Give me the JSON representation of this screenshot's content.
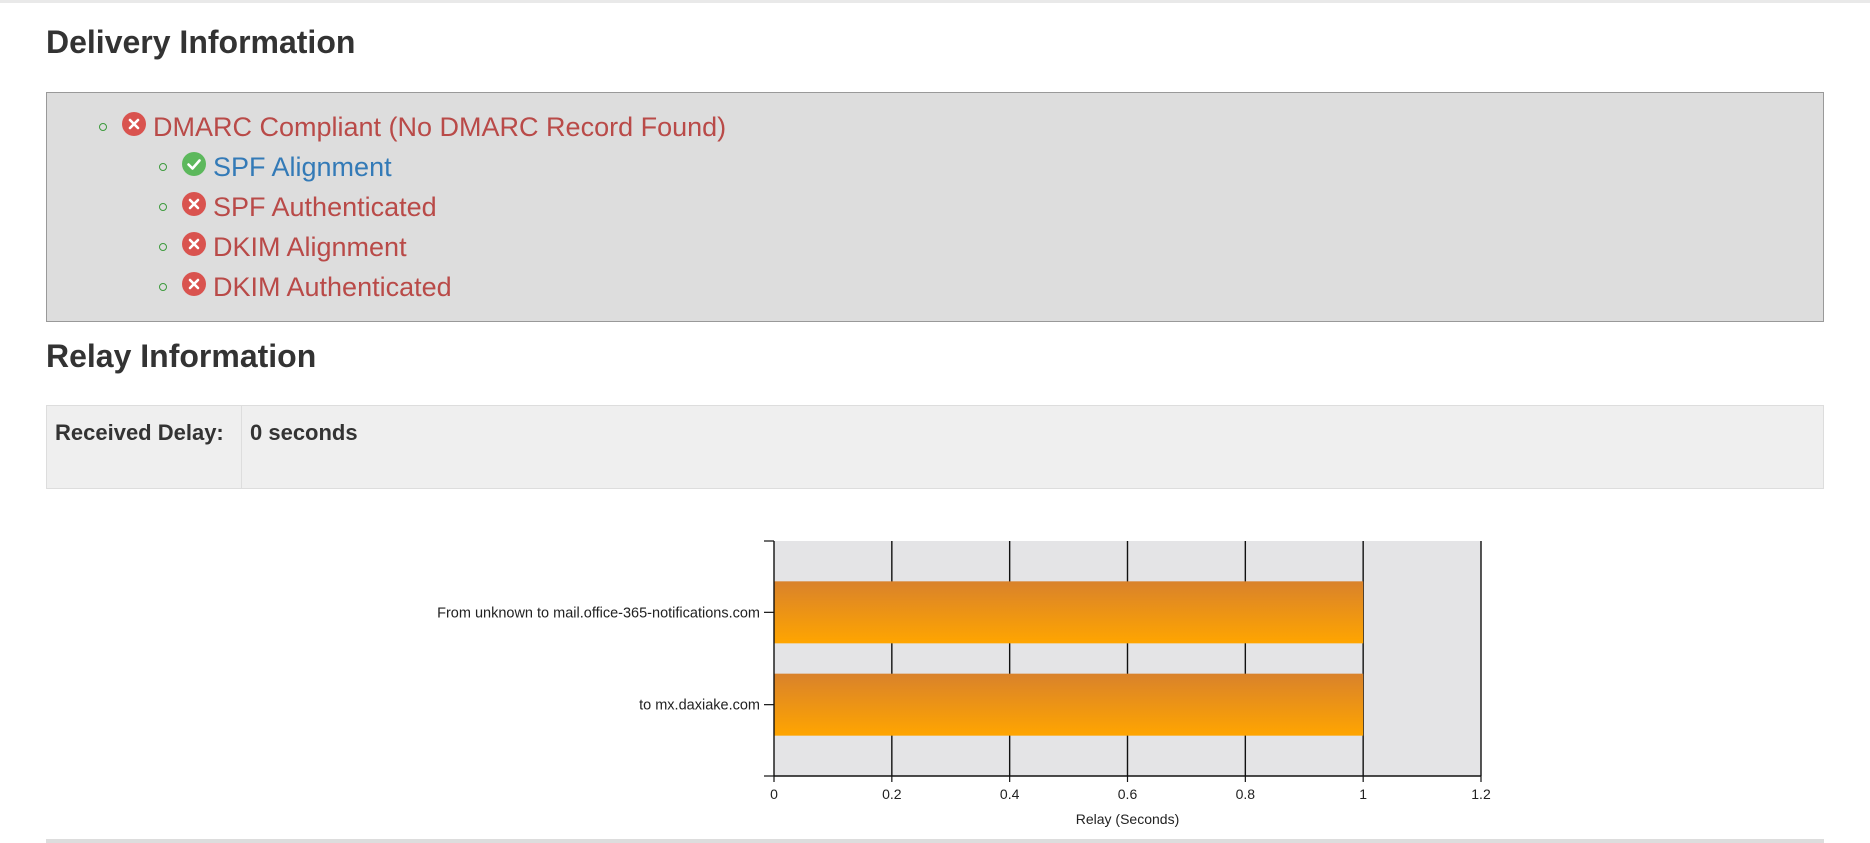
{
  "delivery": {
    "title": "Delivery Information",
    "items": [
      {
        "label": "DMARC Compliant (No DMARC Record Found)",
        "status": "fail",
        "level": 1
      },
      {
        "label": "SPF Alignment",
        "status": "pass",
        "level": 2
      },
      {
        "label": "SPF Authenticated",
        "status": "fail",
        "level": 2
      },
      {
        "label": "DKIM Alignment",
        "status": "fail",
        "level": 2
      },
      {
        "label": "DKIM Authenticated",
        "status": "fail",
        "level": 2
      }
    ]
  },
  "relay": {
    "title": "Relay Information",
    "received_delay_label": "Received Delay:",
    "received_delay_value": "0 seconds"
  },
  "colors": {
    "fail": "#d9534f",
    "pass": "#5cb85c",
    "bar_top": "#d9822b",
    "bar_bottom": "#ffa500",
    "plot_bg": "#e4e4e6"
  },
  "chart_data": {
    "type": "bar",
    "orientation": "horizontal",
    "categories": [
      "From unknown to mail.office-365-notifications.com",
      "to mx.daxiake.com"
    ],
    "values": [
      1,
      1
    ],
    "xlabel": "Relay (Seconds)",
    "xlim": [
      0,
      1.2
    ],
    "xticks": [
      "0",
      "0.2",
      "0.4",
      "0.6",
      "0.8",
      "1",
      "1.2"
    ],
    "grid": true
  }
}
